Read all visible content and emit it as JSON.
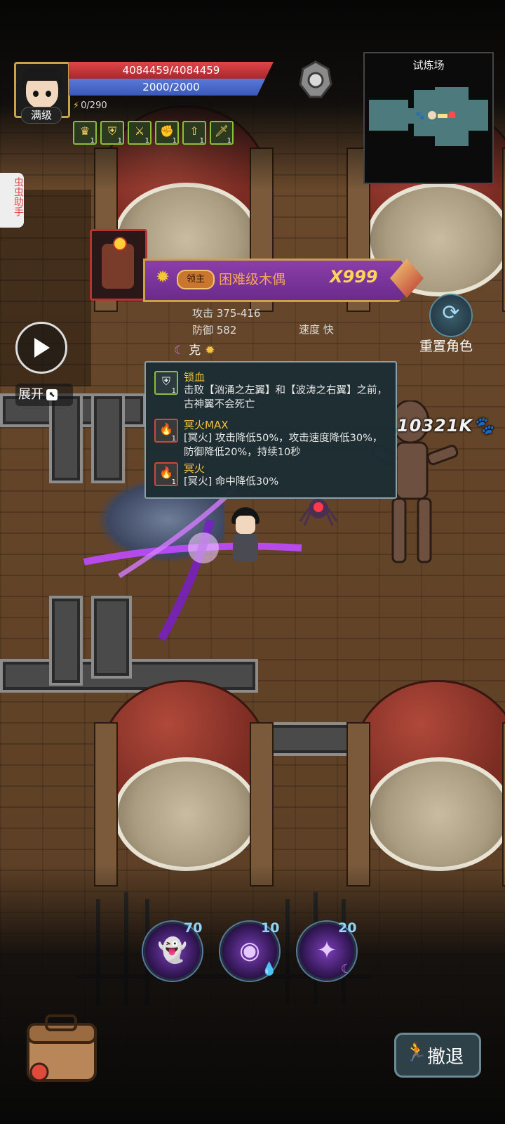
{
  "player": {
    "level_label": "满级",
    "hp_text": "4084459/4084459",
    "mp_text": "2000/2000",
    "energy_text": "0/290",
    "buffs": [
      {
        "icon": "trophy-icon",
        "glyph": "♛",
        "level": "1"
      },
      {
        "icon": "shield-badge-icon",
        "glyph": "⛨",
        "level": "1"
      },
      {
        "icon": "crossed-swords-icon",
        "glyph": "⚔",
        "level": "1"
      },
      {
        "icon": "strength-arm-icon",
        "glyph": "✊",
        "level": "1"
      },
      {
        "icon": "rank-up-icon",
        "glyph": "⇧",
        "level": "1"
      },
      {
        "icon": "sword-icon",
        "glyph": "🗡",
        "level": "1"
      }
    ]
  },
  "minimap": {
    "title": "试炼场"
  },
  "helper": {
    "label": "虫虫助手"
  },
  "boss": {
    "rank": "领主",
    "name": "困难级木偶",
    "count": "X999",
    "attack": "攻击 375-416",
    "defense": "防御 582",
    "speed": "速度 快",
    "counter_label": "克"
  },
  "tooltip": {
    "skills": [
      {
        "icon": "shield-icon",
        "level": "1",
        "title": "锁血",
        "desc": "击败【汹涌之左翼】和【波涛之右翼】之前，古神翼不会死亡"
      },
      {
        "icon": "dark-fire-icon",
        "level": "1",
        "title": "冥火MAX",
        "desc": "[冥火] 攻击降低50%，攻击速度降低30%，防御降低20%，持续10秒"
      },
      {
        "icon": "dark-fire-icon",
        "level": "1",
        "title": "冥火",
        "desc": "[冥火] 命中降低30%"
      }
    ]
  },
  "controls": {
    "expand_label": "展开",
    "reset_label": "重置角色",
    "retreat_label": "撤退"
  },
  "combat": {
    "damage_text": "10321K"
  },
  "skills": [
    {
      "icon": "ghost-summon-icon",
      "cost": "70"
    },
    {
      "icon": "void-orb-icon",
      "cost": "10",
      "element": "water-drop-icon"
    },
    {
      "icon": "shadow-strike-icon",
      "cost": "20",
      "element": "moon-icon"
    }
  ],
  "colors": {
    "hp": "#e0454a",
    "mp": "#5b79d8",
    "boss_banner": "#7a34a0",
    "skill_cost": "#8fd6ff",
    "tooltip_title": "#f3c43e"
  }
}
